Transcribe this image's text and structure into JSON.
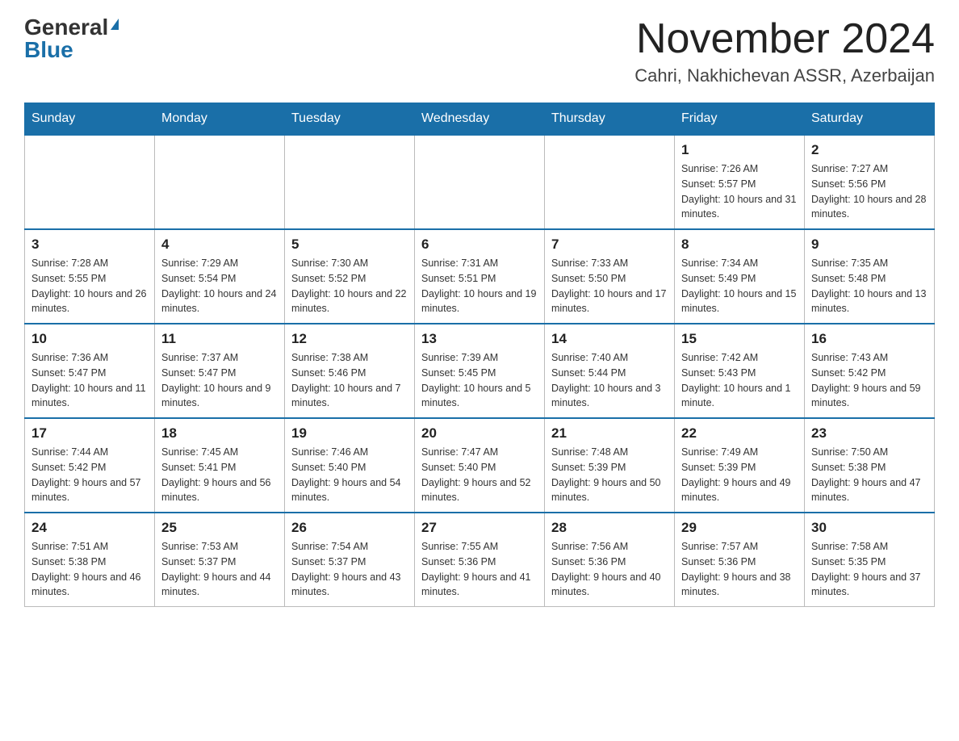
{
  "header": {
    "logo_general": "General",
    "logo_blue": "Blue",
    "month_title": "November 2024",
    "location": "Cahri, Nakhichevan ASSR, Azerbaijan"
  },
  "days_of_week": [
    "Sunday",
    "Monday",
    "Tuesday",
    "Wednesday",
    "Thursday",
    "Friday",
    "Saturday"
  ],
  "weeks": [
    [
      {
        "day": "",
        "info": ""
      },
      {
        "day": "",
        "info": ""
      },
      {
        "day": "",
        "info": ""
      },
      {
        "day": "",
        "info": ""
      },
      {
        "day": "",
        "info": ""
      },
      {
        "day": "1",
        "info": "Sunrise: 7:26 AM\nSunset: 5:57 PM\nDaylight: 10 hours and 31 minutes."
      },
      {
        "day": "2",
        "info": "Sunrise: 7:27 AM\nSunset: 5:56 PM\nDaylight: 10 hours and 28 minutes."
      }
    ],
    [
      {
        "day": "3",
        "info": "Sunrise: 7:28 AM\nSunset: 5:55 PM\nDaylight: 10 hours and 26 minutes."
      },
      {
        "day": "4",
        "info": "Sunrise: 7:29 AM\nSunset: 5:54 PM\nDaylight: 10 hours and 24 minutes."
      },
      {
        "day": "5",
        "info": "Sunrise: 7:30 AM\nSunset: 5:52 PM\nDaylight: 10 hours and 22 minutes."
      },
      {
        "day": "6",
        "info": "Sunrise: 7:31 AM\nSunset: 5:51 PM\nDaylight: 10 hours and 19 minutes."
      },
      {
        "day": "7",
        "info": "Sunrise: 7:33 AM\nSunset: 5:50 PM\nDaylight: 10 hours and 17 minutes."
      },
      {
        "day": "8",
        "info": "Sunrise: 7:34 AM\nSunset: 5:49 PM\nDaylight: 10 hours and 15 minutes."
      },
      {
        "day": "9",
        "info": "Sunrise: 7:35 AM\nSunset: 5:48 PM\nDaylight: 10 hours and 13 minutes."
      }
    ],
    [
      {
        "day": "10",
        "info": "Sunrise: 7:36 AM\nSunset: 5:47 PM\nDaylight: 10 hours and 11 minutes."
      },
      {
        "day": "11",
        "info": "Sunrise: 7:37 AM\nSunset: 5:47 PM\nDaylight: 10 hours and 9 minutes."
      },
      {
        "day": "12",
        "info": "Sunrise: 7:38 AM\nSunset: 5:46 PM\nDaylight: 10 hours and 7 minutes."
      },
      {
        "day": "13",
        "info": "Sunrise: 7:39 AM\nSunset: 5:45 PM\nDaylight: 10 hours and 5 minutes."
      },
      {
        "day": "14",
        "info": "Sunrise: 7:40 AM\nSunset: 5:44 PM\nDaylight: 10 hours and 3 minutes."
      },
      {
        "day": "15",
        "info": "Sunrise: 7:42 AM\nSunset: 5:43 PM\nDaylight: 10 hours and 1 minute."
      },
      {
        "day": "16",
        "info": "Sunrise: 7:43 AM\nSunset: 5:42 PM\nDaylight: 9 hours and 59 minutes."
      }
    ],
    [
      {
        "day": "17",
        "info": "Sunrise: 7:44 AM\nSunset: 5:42 PM\nDaylight: 9 hours and 57 minutes."
      },
      {
        "day": "18",
        "info": "Sunrise: 7:45 AM\nSunset: 5:41 PM\nDaylight: 9 hours and 56 minutes."
      },
      {
        "day": "19",
        "info": "Sunrise: 7:46 AM\nSunset: 5:40 PM\nDaylight: 9 hours and 54 minutes."
      },
      {
        "day": "20",
        "info": "Sunrise: 7:47 AM\nSunset: 5:40 PM\nDaylight: 9 hours and 52 minutes."
      },
      {
        "day": "21",
        "info": "Sunrise: 7:48 AM\nSunset: 5:39 PM\nDaylight: 9 hours and 50 minutes."
      },
      {
        "day": "22",
        "info": "Sunrise: 7:49 AM\nSunset: 5:39 PM\nDaylight: 9 hours and 49 minutes."
      },
      {
        "day": "23",
        "info": "Sunrise: 7:50 AM\nSunset: 5:38 PM\nDaylight: 9 hours and 47 minutes."
      }
    ],
    [
      {
        "day": "24",
        "info": "Sunrise: 7:51 AM\nSunset: 5:38 PM\nDaylight: 9 hours and 46 minutes."
      },
      {
        "day": "25",
        "info": "Sunrise: 7:53 AM\nSunset: 5:37 PM\nDaylight: 9 hours and 44 minutes."
      },
      {
        "day": "26",
        "info": "Sunrise: 7:54 AM\nSunset: 5:37 PM\nDaylight: 9 hours and 43 minutes."
      },
      {
        "day": "27",
        "info": "Sunrise: 7:55 AM\nSunset: 5:36 PM\nDaylight: 9 hours and 41 minutes."
      },
      {
        "day": "28",
        "info": "Sunrise: 7:56 AM\nSunset: 5:36 PM\nDaylight: 9 hours and 40 minutes."
      },
      {
        "day": "29",
        "info": "Sunrise: 7:57 AM\nSunset: 5:36 PM\nDaylight: 9 hours and 38 minutes."
      },
      {
        "day": "30",
        "info": "Sunrise: 7:58 AM\nSunset: 5:35 PM\nDaylight: 9 hours and 37 minutes."
      }
    ]
  ]
}
